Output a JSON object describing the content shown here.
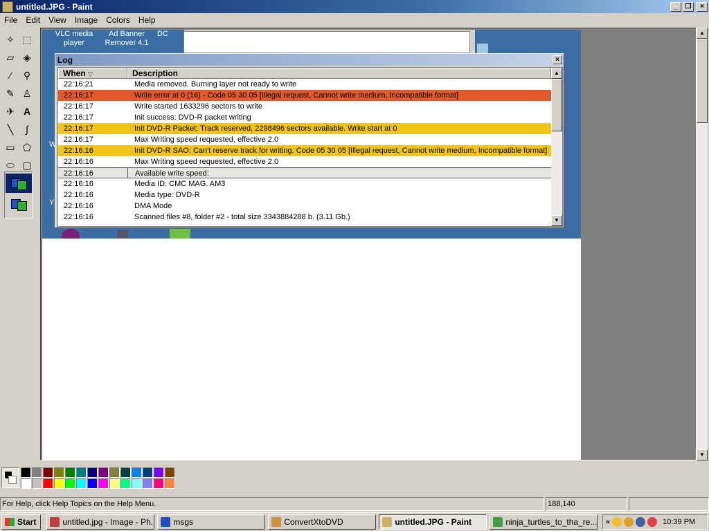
{
  "window": {
    "title": "untitled.JPG - Paint"
  },
  "menu": [
    "File",
    "Edit",
    "View",
    "Image",
    "Colors",
    "Help"
  ],
  "desktop_labels": [
    {
      "line1": "VLC media",
      "line2": "player"
    },
    {
      "line1": "Ad Banner",
      "line2": "Remover 4.1"
    },
    {
      "line1": "DC",
      "line2": ""
    }
  ],
  "desktop_partial_letters": [
    "W",
    "Y"
  ],
  "log": {
    "title": "Log",
    "columns": {
      "when": "When",
      "description": "Description"
    },
    "rows": [
      {
        "when": "22:16:21",
        "desc": "Media removed. Burning layer not ready to write",
        "level": "normal"
      },
      {
        "when": "22:16:17",
        "desc": "Write error at 0 (16) - Code 05 30 05 [Illegal request, Cannot write medium, Incompatible format]",
        "level": "error"
      },
      {
        "when": "22:16:17",
        "desc": "Write started 1633296 sectors to write",
        "level": "normal"
      },
      {
        "when": "22:16:17",
        "desc": "Init success: DVD-R packet writing",
        "level": "normal"
      },
      {
        "when": "22:16:17",
        "desc": "Init DVD-R Packet: Track reserved, 2298496 sectors available. Write start at 0",
        "level": "warn"
      },
      {
        "when": "22:16:17",
        "desc": "Max Writing speed requested, effective 2.0",
        "level": "normal"
      },
      {
        "when": "22:16:16",
        "desc": "Init DVD-R SAO: Can't reserve track for writing. Code 05 30 05 [Illegal request, Cannot write medium, Incompatible format]",
        "level": "warn"
      },
      {
        "when": "22:16:16",
        "desc": "Max Writing speed requested, effective 2.0",
        "level": "normal"
      },
      {
        "when": "22:16:16",
        "desc": "Available write speed:",
        "level": "selected"
      },
      {
        "when": "22:16:16",
        "desc": "Media ID: CMC MAG. AM3",
        "level": "normal"
      },
      {
        "when": "22:16:16",
        "desc": "Media type: DVD-R",
        "level": "normal"
      },
      {
        "when": "22:16:16",
        "desc": "DMA Mode",
        "level": "normal"
      },
      {
        "when": "22:16:16",
        "desc": "Scanned files #8, folder #2 - total size 3343884288 b. (3.11 Gb.)",
        "level": "normal"
      }
    ]
  },
  "palette": {
    "colors": [
      "#000000",
      "#808080",
      "#800000",
      "#808000",
      "#008000",
      "#008080",
      "#000080",
      "#800080",
      "#808040",
      "#004040",
      "#0080ff",
      "#004080",
      "#8000ff",
      "#804000",
      "#ffffff",
      "#c0c0c0",
      "#ff0000",
      "#ffff00",
      "#00ff00",
      "#00ffff",
      "#0000ff",
      "#ff00ff",
      "#ffff80",
      "#00ff80",
      "#80ffff",
      "#8080ff",
      "#ff0080",
      "#ff8040"
    ]
  },
  "status": {
    "help": "For Help, click Help Topics on the Help Menu.",
    "coords": "188,140"
  },
  "taskbar": {
    "start": "Start",
    "tasks": [
      {
        "label": "untitled.jpg - Image - Ph...",
        "active": false
      },
      {
        "label": "msgs",
        "active": false
      },
      {
        "label": "ConvertXtoDVD",
        "active": false
      },
      {
        "label": "untitled.JPG - Paint",
        "active": true
      },
      {
        "label": "ninja_turtles_to_tha_re...",
        "active": false
      }
    ],
    "tray_chevron": "«",
    "clock": "10:39 PM"
  }
}
